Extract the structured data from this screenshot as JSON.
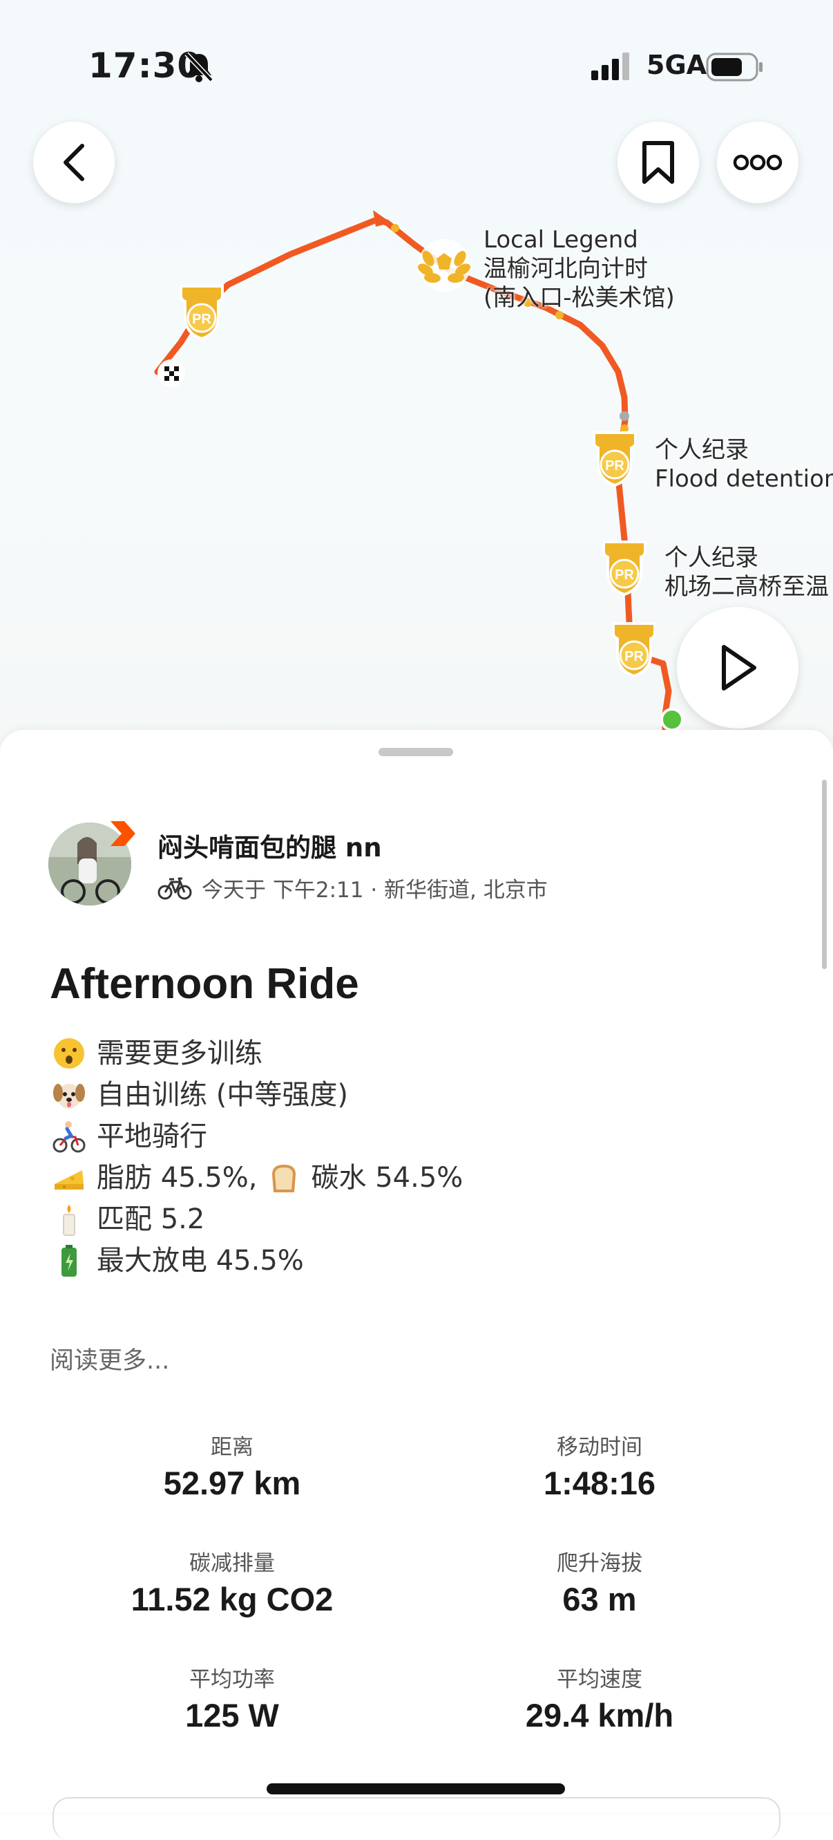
{
  "status_bar": {
    "time": "17:30",
    "network": "5GA"
  },
  "map": {
    "labels": {
      "legend_title": "Local Legend",
      "legend_segment": "温榆河北向计时",
      "legend_segment2": "(南入口-松美术馆)",
      "pr1_title": "个人纪录",
      "pr1_segment": "Flood detention",
      "pr2_title": "个人纪录",
      "pr2_segment": "机场二高桥至温"
    },
    "badge_text": "PR"
  },
  "athlete": {
    "name": "闷头啃面包的腿 nn",
    "meta": "今天于 下午2:11 · 新华街道, 北京市"
  },
  "activity": {
    "title": "Afternoon Ride",
    "description": [
      {
        "icon": "astonished-face-emoji",
        "text": "需要更多训练"
      },
      {
        "icon": "dog-face-emoji",
        "text": "自由训练 (中等强度)"
      },
      {
        "icon": "cyclist-emoji",
        "text": "平地骑行"
      },
      {
        "icon": "cheese-emoji",
        "text": "脂肪 45.5%,",
        "icon2": "bread-emoji",
        "text2": "碳水 54.5%"
      },
      {
        "icon": "candle-emoji",
        "text": "匹配 5.2"
      },
      {
        "icon": "battery-emoji",
        "text": "最大放电 45.5%"
      }
    ],
    "read_more": "阅读更多..."
  },
  "stats": [
    {
      "label": "距离",
      "value": "52.97 km"
    },
    {
      "label": "移动时间",
      "value": "1:48:16"
    },
    {
      "label": "碳减排量",
      "value": "11.52 kg CO2"
    },
    {
      "label": "爬升海拔",
      "value": "63 m"
    },
    {
      "label": "平均功率",
      "value": "125 W"
    },
    {
      "label": "平均速度",
      "value": "29.4 km/h"
    }
  ],
  "colors": {
    "route": "#f05a22",
    "badge": "#f0b429",
    "start": "#58c23e",
    "accent": "#fc5200"
  }
}
